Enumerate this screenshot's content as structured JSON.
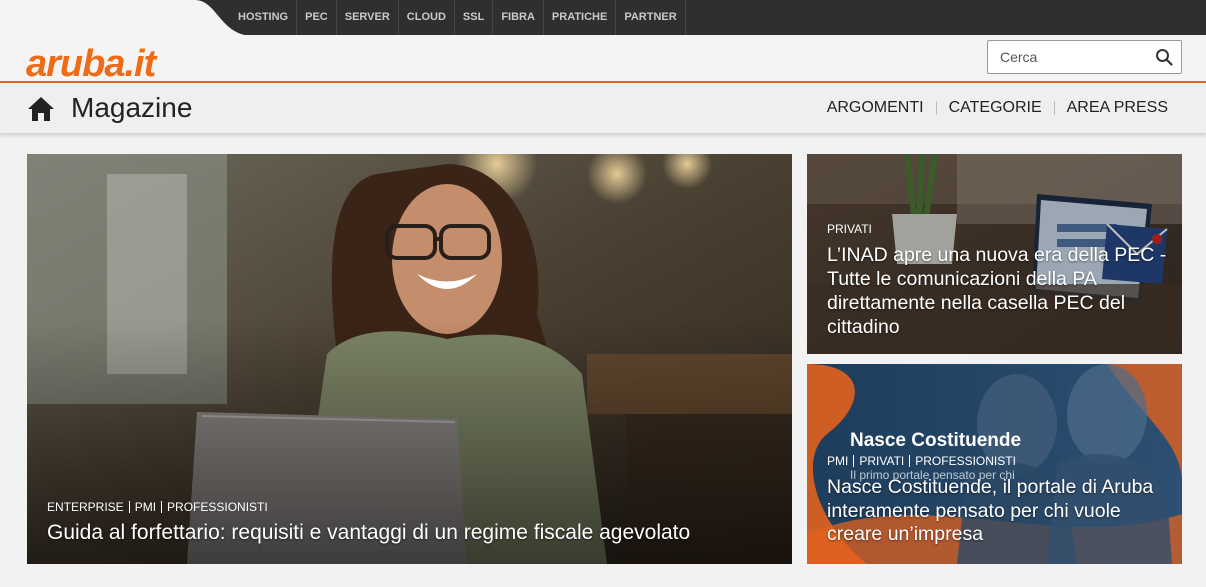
{
  "brand": {
    "logo": "aruba.it",
    "accent": "#e2621e"
  },
  "topnav": [
    "HOSTING",
    "PEC",
    "SERVER",
    "CLOUD",
    "SSL",
    "FIBRA",
    "PRATICHE",
    "PARTNER"
  ],
  "search": {
    "placeholder": "Cerca",
    "icon": "search-icon"
  },
  "magazine": {
    "title": "Magazine",
    "home_icon": "home-icon",
    "nav": [
      "ARGOMENTI",
      "CATEGORIE",
      "AREA PRESS"
    ]
  },
  "articles": [
    {
      "tags": [
        "ENTERPRISE",
        "PMI",
        "PROFESSIONISTI"
      ],
      "headline": "Guida al forfettario: requisiti e vantaggi di un regime fiscale agevolato"
    },
    {
      "tags": [
        "PRIVATI"
      ],
      "headline": "L’INAD apre una nuova era della PEC - Tutte le comunicazioni della PA direttamente nella casella PEC del cittadino"
    },
    {
      "tags": [
        "PMI",
        "PRIVATI",
        "PROFESSIONISTI"
      ],
      "headline": "Nasce Costituende, il portale di Aruba interamente pensato per chi vuole creare un’impresa",
      "image_title": "Nasce Costituende",
      "image_subtitle": "Il primo portale pensato per chi"
    }
  ]
}
